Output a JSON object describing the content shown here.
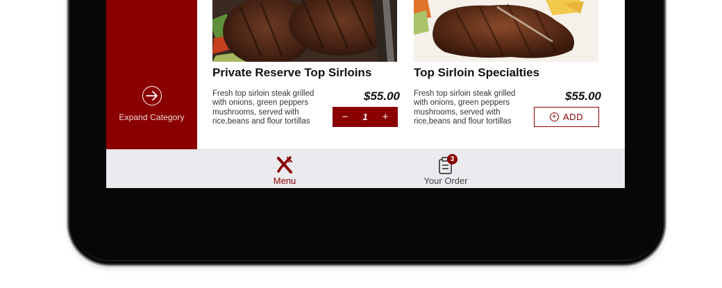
{
  "theme": {
    "accent": "#8a0000",
    "nav_bg": "#ebeaee",
    "device": "#070708"
  },
  "sidebar": {
    "expand_label": "Expand Category",
    "expand_icon": "arrow-right-circle-icon"
  },
  "items": [
    {
      "title": "Private Reserve Top Sirloins",
      "description": "Fresh top sirloin steak grilled with onions, green peppers mushrooms, served with rice,beans and flour tortillas",
      "price": "$55.00",
      "quantity": "1",
      "decrement": "−",
      "increment": "+"
    },
    {
      "title": "Top Sirloin Specialties",
      "description": "Fresh top sirloin steak grilled with onions, green peppers mushrooms, served with rice,beans and flour tortillas",
      "price": "$55.00",
      "add_label": "ADD"
    }
  ],
  "bottom_nav": {
    "menu_label": "Menu",
    "menu_icon": "fork-knife-icon",
    "order_label": "Your Order",
    "order_icon": "clipboard-icon",
    "order_badge": "3"
  }
}
